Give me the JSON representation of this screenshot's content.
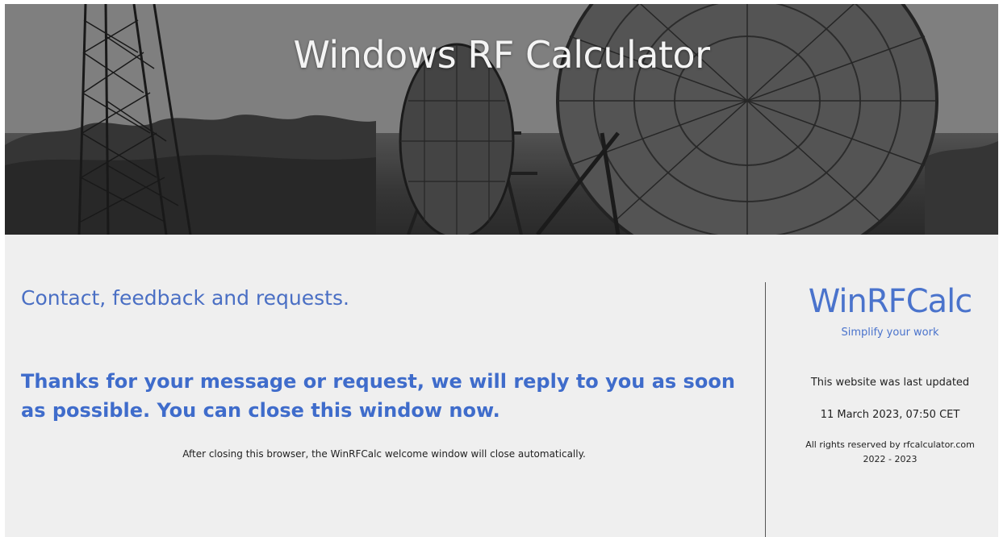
{
  "header": {
    "title": "Windows RF Calculator"
  },
  "main": {
    "heading": "Contact, feedback and requests.",
    "thanks_message": "Thanks for your message or request, we will reply to you as soon as possible. You can close this window now.",
    "close_note": "After closing this browser, the WinRFCalc welcome window will close automatically."
  },
  "sidebar": {
    "logo": "WinRFCalc",
    "tagline": "Simplify your work",
    "updated_label": "This website was last updated",
    "updated_date": "11 March 2023, 07:50 CET",
    "rights": "All rights reserved by rfcalculator.com",
    "years": "2022 - 2023"
  },
  "colors": {
    "accent": "#4a73cc",
    "background": "#efefef",
    "text": "#222222"
  }
}
